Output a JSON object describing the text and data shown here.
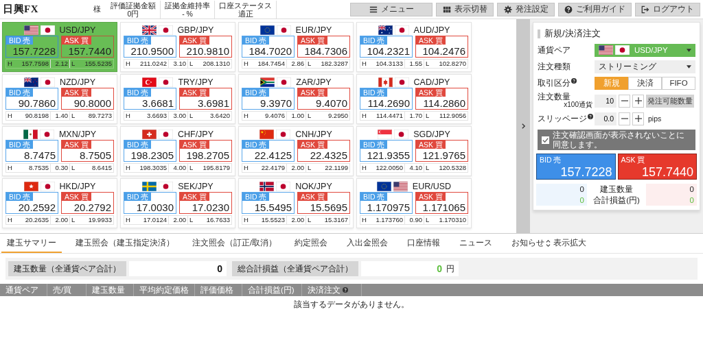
{
  "header": {
    "logo": "日興FX",
    "user_suffix": "様",
    "stats": [
      {
        "label": "評価証拠金額",
        "value": "0円"
      },
      {
        "label": "証拠金維持率",
        "value": "- %"
      },
      {
        "label": "口座ステータス",
        "value": "適正"
      }
    ],
    "buttons": [
      {
        "label": "メニュー"
      },
      {
        "label": "表示切替"
      },
      {
        "label": "発注設定"
      },
      {
        "label": "ご利用ガイド"
      },
      {
        "label": "ログアウト"
      }
    ]
  },
  "tiles": [
    {
      "pair": "USD/JPY",
      "selected": true,
      "bid_label": "BID 売",
      "bid": "157.7228",
      "ask_label": "ASK 買",
      "ask": "157.7440",
      "h_label": "H",
      "high": "157.7598",
      "spread": "2.12",
      "l_label": "L",
      "low": "155.5235"
    },
    {
      "pair": "GBP/JPY",
      "selected": false,
      "bid_label": "BID 売",
      "bid": "210.9500",
      "ask_label": "ASK 買",
      "ask": "210.9810",
      "h_label": "H",
      "high": "211.0242",
      "spread": "3.10",
      "l_label": "L",
      "low": "208.1310"
    },
    {
      "pair": "EUR/JPY",
      "selected": false,
      "bid_label": "BID 売",
      "bid": "184.7020",
      "ask_label": "ASK 買",
      "ask": "184.7306",
      "h_label": "H",
      "high": "184.7454",
      "spread": "2.86",
      "l_label": "L",
      "low": "182.3287"
    },
    {
      "pair": "AUD/JPY",
      "selected": false,
      "bid_label": "BID 売",
      "bid": "104.2321",
      "ask_label": "ASK 買",
      "ask": "104.2476",
      "h_label": "H",
      "high": "104.3133",
      "spread": "1.55",
      "l_label": "L",
      "low": "102.8270"
    },
    {
      "pair": "NZD/JPY",
      "selected": false,
      "bid_label": "BID 売",
      "bid": "90.7860",
      "ask_label": "ASK 買",
      "ask": "90.8000",
      "h_label": "H",
      "high": "90.8198",
      "spread": "1.40",
      "l_label": "L",
      "low": "89.7273"
    },
    {
      "pair": "TRY/JPY",
      "selected": false,
      "bid_label": "BID 売",
      "bid": "3.6681",
      "ask_label": "ASK 買",
      "ask": "3.6981",
      "h_label": "H",
      "high": "3.6693",
      "spread": "3.00",
      "l_label": "L",
      "low": "3.6420"
    },
    {
      "pair": "ZAR/JPY",
      "selected": false,
      "bid_label": "BID 売",
      "bid": "9.3970",
      "ask_label": "ASK 買",
      "ask": "9.4070",
      "h_label": "H",
      "high": "9.4076",
      "spread": "1.00",
      "l_label": "L",
      "low": "9.2950"
    },
    {
      "pair": "CAD/JPY",
      "selected": false,
      "bid_label": "BID 売",
      "bid": "114.2690",
      "ask_label": "ASK 買",
      "ask": "114.2860",
      "h_label": "H",
      "high": "114.4471",
      "spread": "1.70",
      "l_label": "L",
      "low": "112.9056"
    },
    {
      "pair": "MXN/JPY",
      "selected": false,
      "bid_label": "BID 売",
      "bid": "8.7475",
      "ask_label": "ASK 買",
      "ask": "8.7505",
      "h_label": "H",
      "high": "8.7535",
      "spread": "0.30",
      "l_label": "L",
      "low": "8.6415"
    },
    {
      "pair": "CHF/JPY",
      "selected": false,
      "bid_label": "BID 売",
      "bid": "198.2305",
      "ask_label": "ASK 買",
      "ask": "198.2705",
      "h_label": "H",
      "high": "198.3035",
      "spread": "4.00",
      "l_label": "L",
      "low": "195.8179"
    },
    {
      "pair": "CNH/JPY",
      "selected": false,
      "bid_label": "BID 売",
      "bid": "22.4125",
      "ask_label": "ASK 買",
      "ask": "22.4325",
      "h_label": "H",
      "high": "22.4179",
      "spread": "2.00",
      "l_label": "L",
      "low": "22.1199"
    },
    {
      "pair": "SGD/JPY",
      "selected": false,
      "bid_label": "BID 売",
      "bid": "121.9355",
      "ask_label": "ASK 買",
      "ask": "121.9765",
      "h_label": "H",
      "high": "122.0050",
      "spread": "4.10",
      "l_label": "L",
      "low": "120.5328"
    },
    {
      "pair": "HKD/JPY",
      "selected": false,
      "bid_label": "BID 売",
      "bid": "20.2592",
      "ask_label": "ASK 買",
      "ask": "20.2792",
      "h_label": "H",
      "high": "20.2635",
      "spread": "2.00",
      "l_label": "L",
      "low": "19.9933"
    },
    {
      "pair": "SEK/JPY",
      "selected": false,
      "bid_label": "BID 売",
      "bid": "17.0030",
      "ask_label": "ASK 買",
      "ask": "17.0230",
      "h_label": "H",
      "high": "17.0124",
      "spread": "2.00",
      "l_label": "L",
      "low": "16.7633"
    },
    {
      "pair": "NOK/JPY",
      "selected": false,
      "bid_label": "BID 売",
      "bid": "15.5495",
      "ask_label": "ASK 買",
      "ask": "15.5695",
      "h_label": "H",
      "high": "15.5523",
      "spread": "2.00",
      "l_label": "L",
      "low": "15.3167"
    },
    {
      "pair": "EUR/USD",
      "selected": false,
      "bid_label": "BID 売",
      "bid": "1.170975",
      "ask_label": "ASK 買",
      "ask": "1.171065",
      "h_label": "H",
      "high": "1.173760",
      "spread": "0.90",
      "l_label": "L",
      "low": "1.170310"
    }
  ],
  "order_panel": {
    "title": "新規/決済注文",
    "pair_label": "通貨ペア",
    "pair": {
      "value": "USD/JPY"
    },
    "type_label": "注文種類",
    "type_value": "ストリーミング",
    "side_label": "取引区分",
    "side_options": [
      {
        "label": "新規",
        "selected": true
      },
      {
        "label": "決済",
        "selected": false
      },
      {
        "label": "FIFO",
        "selected": false
      }
    ],
    "qty_label": "注文数量",
    "qty_unit": "x100通貨",
    "qty": "10",
    "max_qty_button": "発注可能数量",
    "slip_label": "スリッページ",
    "slip": "0.0",
    "slip_unit": "pips",
    "confirm": {
      "label": "注文確認画面が表示されないことに同意します。",
      "checked": true
    },
    "bid": {
      "label": "BID 売",
      "price": "157.7228"
    },
    "ask": {
      "label": "ASK 買",
      "price": "157.7440"
    },
    "summary": [
      {
        "label": "建玉数量",
        "bid": "0",
        "ask": "0",
        "kind": "count"
      },
      {
        "label": "合計損益(円)",
        "bid": "0",
        "ask": "0",
        "kind": "pnl"
      }
    ]
  },
  "bottom_tabs": [
    {
      "label": "建玉サマリー",
      "selected": true
    },
    {
      "label": "建玉照会（建玉指定決済）",
      "selected": false
    },
    {
      "label": "注文照会（訂正/取消）",
      "selected": false
    },
    {
      "label": "約定照会",
      "selected": false
    },
    {
      "label": "入出金照会",
      "selected": false
    },
    {
      "label": "口座情報",
      "selected": false
    },
    {
      "label": "ニュース",
      "selected": false
    },
    {
      "label": "お知らせ",
      "selected": false
    }
  ],
  "expand": "表示拡大",
  "totals": [
    {
      "label": "建玉数量（全通貨ペア合計）",
      "value": "0",
      "kind": "count"
    },
    {
      "label": "総合計損益（全通貨ペア合計）",
      "value": "0",
      "unit": "円",
      "kind": "pnl"
    }
  ],
  "table": {
    "columns": [
      {
        "label": "通貨ペア"
      },
      {
        "label": "売/買"
      },
      {
        "label": "建玉数量"
      },
      {
        "label": "平均約定価格"
      },
      {
        "label": "評価価格"
      },
      {
        "label": "合計損益(円)"
      },
      {
        "label": "決済注文"
      }
    ],
    "empty_message": "該当するデータがありません。"
  }
}
